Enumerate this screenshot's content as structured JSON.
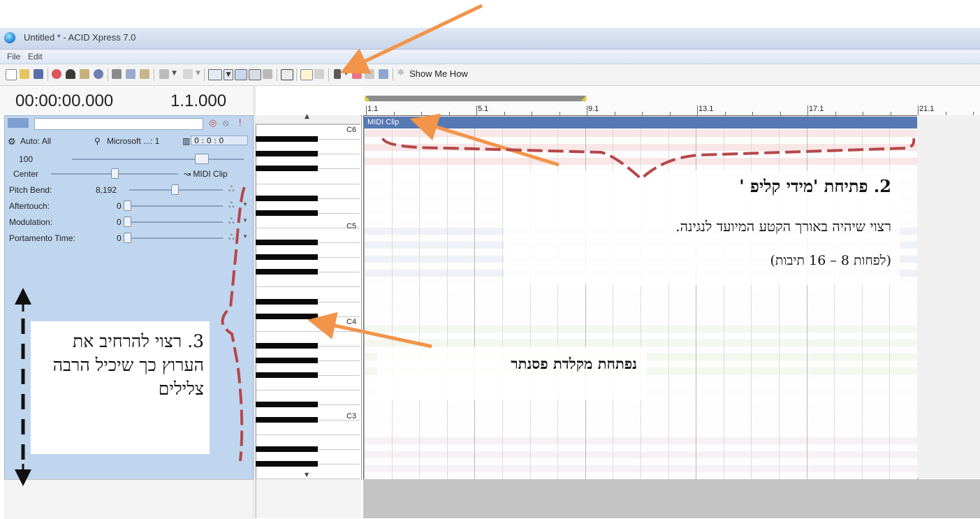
{
  "window": {
    "title": "Untitled * - ACID Xpress 7.0"
  },
  "menu": {
    "file": "File",
    "edit": "Edit"
  },
  "toolbar": {
    "show_me_how": "Show Me How"
  },
  "time": {
    "timecode": "00:00:00.000",
    "measure": "1.1.000"
  },
  "track": {
    "auto": "Auto: All",
    "device": "Microsoft ...: 1",
    "position": "0 : 0 : 0",
    "volume": "100",
    "pan": "Center",
    "clip_target": "MIDI Clip",
    "controls": [
      {
        "label": "Pitch Bend:",
        "value": "8,192",
        "level": 0.5
      },
      {
        "label": "Aftertouch:",
        "value": "0",
        "level": 0
      },
      {
        "label": "Modulation:",
        "value": "0",
        "level": 0
      },
      {
        "label": "Portamento Time:",
        "value": "0",
        "level": 0
      }
    ]
  },
  "piano": {
    "labels": [
      "C6",
      "C5",
      "C4",
      "C3"
    ]
  },
  "ruler": {
    "markers": [
      "1.1",
      "5.1",
      "9.1",
      "13.1",
      "17.1",
      "21.1"
    ]
  },
  "clip": {
    "name": "MIDI Clip"
  },
  "annotations": {
    "step2_title": "2. פתיחת 'מידי קליפ '",
    "step2_line1": "רצוי שיהיה באורך הקטע המיועד לנגינה.",
    "step2_line2": "(לפחות 8 – 16 תיבות)",
    "keyboard_note": "נפתחת מקלדת פסנתר",
    "step3": "3. רצוי להרחיב את הערוץ כך שיכיל הרבה צלילים"
  },
  "colors": {
    "accent_arrow": "#f2944a",
    "dashed_line": "#b5474a",
    "clip_header": "#5679b3",
    "track_panel": "#c0d6ef"
  }
}
